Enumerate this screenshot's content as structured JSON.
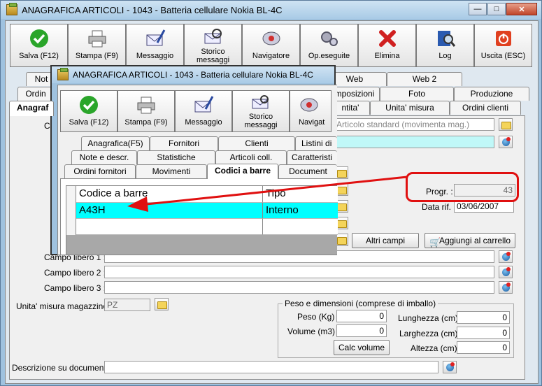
{
  "main": {
    "title": "ANAGRAFICA ARTICOLI - 1043 - Batteria cellulare Nokia BL-4C",
    "toolbar": [
      {
        "label": "Salva (F12)",
        "icon": "check-icon"
      },
      {
        "label": "Stampa (F9)",
        "icon": "printer-icon"
      },
      {
        "label": "Messaggio",
        "icon": "message-icon"
      },
      {
        "label": "Storico messaggi",
        "icon": "history-icon"
      },
      {
        "label": "Navigatore",
        "icon": "navigator-icon"
      },
      {
        "label": "Op.eseguite",
        "icon": "gears-icon"
      },
      {
        "label": "Elimina",
        "icon": "delete-icon"
      },
      {
        "label": "Log",
        "icon": "log-icon"
      },
      {
        "label": "Uscita (ESC)",
        "icon": "exit-icon"
      }
    ],
    "tabs_row1": [
      "Not",
      "Web",
      "Web 2"
    ],
    "tabs_row2": [
      "Ordin",
      "mposizioni",
      "Foto",
      "Produzione"
    ],
    "tabs_row3": [
      "Anagraf",
      "ntita'",
      "Unita' misura",
      "Ordini clienti"
    ],
    "field_c_label": "C",
    "field_type_value": "Articolo standard (movimenta mag.)",
    "progr_label": "Progr. :",
    "progr_value": "43",
    "data_label": "Data rif. :",
    "data_value": "03/06/2007",
    "altri_campi": "Altri campi",
    "aggiungi_carrello": "Aggiungi al carrello",
    "campo1": "Campo libero 1 :",
    "campo2": "Campo libero 2 :",
    "campo3": "Campo libero 3 :",
    "um_label": "Unita' misura magazzino :",
    "um_value": "PZ",
    "group_title": "Peso e dimensioni (comprese di imballo)",
    "peso_label": "Peso (Kg) :",
    "peso_value": "0",
    "volume_label": "Volume (m3) :",
    "volume_value": "0",
    "lunghezza_label": "Lunghezza (cm) :",
    "lunghezza_value": "0",
    "larghezza_label": "Larghezza (cm) :",
    "larghezza_value": "0",
    "altezza_label": "Altezza (cm) :",
    "altezza_value": "0",
    "calc_volume": "Calc volume",
    "descr_label": "Descrizione su documenti:"
  },
  "popup": {
    "title": "ANAGRAFICA ARTICOLI - 1043 - Batteria cellulare Nokia BL-4C",
    "toolbar": [
      {
        "label": "Salva (F12)",
        "icon": "check-icon"
      },
      {
        "label": "Stampa (F9)",
        "icon": "printer-icon"
      },
      {
        "label": "Messaggio",
        "icon": "message-icon"
      },
      {
        "label": "Storico messaggi",
        "icon": "history-icon"
      },
      {
        "label": "Navigat",
        "icon": "navigator-icon"
      }
    ],
    "tabs_row1": [
      "Anagrafica(F5)",
      "Fornitori",
      "Clienti",
      "Listini di v"
    ],
    "tabs_row2": [
      "Note e descr.",
      "Statistiche",
      "Articoli coll.",
      "Caratteristi"
    ],
    "tabs_row3": [
      "Ordini fornitori",
      "Movimenti",
      "Codici a barre",
      "Document"
    ],
    "grid_headers": [
      "Codice a barre",
      "Tipo"
    ],
    "grid_rows": [
      [
        "A43H",
        "Interno"
      ],
      [
        "",
        ""
      ]
    ]
  },
  "colors": {
    "annotation": "#e01010",
    "selection": "#00ffff",
    "chrome": "#9fc2df"
  }
}
